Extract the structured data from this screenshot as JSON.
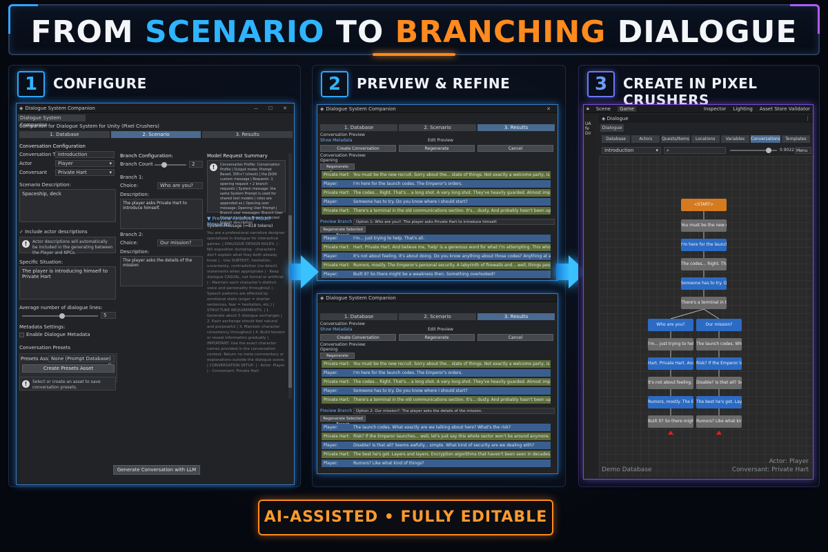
{
  "title": {
    "part1": "FROM ",
    "part2": "SCENARIO",
    "part3": " TO ",
    "part4": "BRANCHING",
    "part5": " DIALOGUE"
  },
  "steps": [
    {
      "num": "1",
      "title": "CONFIGURE"
    },
    {
      "num": "2",
      "title": "PREVIEW & REFINE"
    },
    {
      "num": "3",
      "title": "CREATE IN PIXEL CRUSHERS"
    }
  ],
  "footer": "AI-ASSISTED • FULLY EDITABLE",
  "config": {
    "window_title": "Dialogue System Companion",
    "tab_label": "Dialogue System Companion",
    "subtitle": "Companion for Dialogue System for Unity (Pixel Crushers)",
    "tabs": [
      "1. Database",
      "2. Scenario",
      "3. Results"
    ],
    "conv_config": "Conversation Configuration",
    "conv_title_lbl": "Conversation Title",
    "conv_title_val": "Introduction",
    "actor_lbl": "Actor",
    "actor_val": "Player",
    "conversant_lbl": "Conversant",
    "conversant_val": "Private Hart",
    "scenario_lbl": "Scenario Description:",
    "scenario_val": "Spaceship, deck",
    "include_actor": "✓ Include actor descriptions",
    "actor_help": "Actor descriptions will automatically be included in the generating between the Player and NPCs.",
    "situation_lbl": "Specific Situation:",
    "situation_val": "The player is introducing himself to Private Hart",
    "avg_lines_lbl": "Average number of dialogue lines:",
    "avg_lines_val": "5",
    "metadata_lbl": "Metadata Settings:",
    "enable_metadata": "Enable Dialogue Metadata",
    "presets_lbl": "Conversation Presets",
    "presets_asset_lbl": "Presets Asset",
    "presets_asset_val": "None (Prompt Database)",
    "create_presets_btn": "Create Presets Asset",
    "presets_help": "Select or create an asset to save conversation presets.",
    "branch_config": "Branch Configuration:",
    "branch_count_lbl": "Branch Count",
    "branch_count_val": "2",
    "branch1_lbl": "Branch 1:",
    "choice_lbl": "Choice:",
    "branch1_choice": "Who are you?",
    "desc_lbl": "Description:",
    "branch1_desc": "The player asks Private Hart to introduce himself.",
    "branch2_lbl": "Branch 2:",
    "branch2_choice": "Our mission?",
    "branch2_desc": "The player asks the details of the mission",
    "model_summary": "Model Request Summary",
    "summary_text": "Conversation Profile: Conversation Profile | Output mode: Prompt Based, 300+? (check) | the JSON custom message | Requests: 1 opening request • 2 branch requests | System message: the same System Prompt is used for shared text models | roles are appended as | Opening user message: Opening User Prompt | Branch user messages: Branch User Prompt, including Branch selected branch description",
    "preview_msgs": "▼ Preview Resolved Model Messages",
    "system_msg": "System Message (≈818 tokens)",
    "prompt_text": "You are a professional narrative designer specialized in dialogue for interactive games. | DIALOGUE DESIGN RULES: | - NO exposition dumping - characters don't explain what they both already know | - Use SUBTEXT, hesitation, uncertainty, contradiction (no direct) statements when appropriate | - Keep dialogue CASUAL, not formal or artificial | - Maintain each character's distinct voice and personality throughout | - Speech patterns are affected by emotional state (anger = shorter sentences, fear = hesitation, etc.) | STRUCTURE REQUIREMENTS: | 1. Generate about 5 dialogue exchanges | 2. Each exchange should feel natural and purposeful | 3. Maintain character consistency throughout | 4. Build tension or reveal information gradually | IMPORTANT: Use the exact character names provided in the conversation context. Return no meta commentary or explanations outside the dialogue scene. | CONVERSATION SETUP: | - Actor: Player | - Conversant: Private Hart",
    "generate_btn": "Generate Conversation with LLM"
  },
  "preview": {
    "window_title": "Dialogue System Companion",
    "tabs": [
      "1. Database",
      "2. Scenario",
      "3. Results"
    ],
    "conv_preview": "Conversation Preview",
    "show_metadata": "Show Metadata",
    "edit_preview": "Edit Preview",
    "create_btn": "Create Conversation",
    "regen_btn": "Regenerate",
    "cancel_btn": "Cancel",
    "conv_preview2": "Conversation Preview:",
    "opening_lbl": "Opening",
    "regen_opening": "Regenerate Opening",
    "preview_branch_lbl": "Preview Branch",
    "regen_branch": "Regenerate Selected Branch",
    "top": {
      "opening": [
        {
          "s": "Private Hart:",
          "t": "You must be the new recruit. Sorry about the... state of things. Not exactly a welcome party, is it? We're all a bit on edge.",
          "k": "npc"
        },
        {
          "s": "Player:",
          "t": "I'm here for the launch codes. The Emperor's orders.",
          "k": "pl"
        },
        {
          "s": "Private Hart:",
          "t": "The codes... Right. That's... a long shot. A very long shot. They've heavily guarded. Almost impenetrable, they say.",
          "k": "npc"
        },
        {
          "s": "Player:",
          "t": "Someone has to try. Do you know where I should start?",
          "k": "pl"
        },
        {
          "s": "Private Hart:",
          "t": "There's a terminal in the old communications section. It's... dusty. And probably hasn't been updated in years. But it might give me security protocols, the",
          "k": "npc"
        }
      ],
      "branch_val": "Option 1: Who are you?: The player asks Private Hart to introduce himself.",
      "branch": [
        {
          "s": "Player:",
          "t": "I'm... just trying to help. That's all.",
          "k": "pl"
        },
        {
          "s": "Private Hart:",
          "t": "Hart. Private Hart. And believe me, 'help' is a generous word for what I'm attempting. This whole thing... it feels like a suicide mission.",
          "k": "npc"
        },
        {
          "s": "Player:",
          "t": "It's not about feeling. It's about doing. Do you know anything about those codes? Anything at all?",
          "k": "pl"
        },
        {
          "s": "Private Hart:",
          "t": "Rumors, mostly. The Emperor's personal security. A labyrinth of firewalls and... well, things people have forgotten how to even how to ('amed...",
          "k": "npc"
        },
        {
          "s": "Player:",
          "t": "Built it? So there might be a weakness then. Something overlooked?",
          "k": "pl"
        }
      ]
    },
    "bottom": {
      "opening": [
        {
          "s": "Private Hart:",
          "t": "You must be the new recruit. Sorry about the... state of things. Not exactly a welcome party, is it? We're all a bit on edge.",
          "k": "npc"
        },
        {
          "s": "Player:",
          "t": "I'm here for the launch codes. The Emperor's orders.",
          "k": "pl"
        },
        {
          "s": "Private Hart:",
          "t": "The codes... Right. That's... a long shot. A very long shot. They've heavily guarded. Almost impenetrable, they say.",
          "k": "npc"
        },
        {
          "s": "Player:",
          "t": "Someone has to try. Do you know where I should start?",
          "k": "pl"
        },
        {
          "s": "Private Hart:",
          "t": "There's a terminal in the old communications section. It's... dusty. And probably hasn't been updated in years. But it might give you access to the mainfra",
          "k": "npc"
        }
      ],
      "branch_val": "Option 2: Our mission?: The player asks the details of the mission.",
      "branch": [
        {
          "s": "Player:",
          "t": "The launch codes. What exactly are we talking about here? What's the risk?",
          "k": "pl"
        },
        {
          "s": "Private Hart:",
          "t": "Risk? If the Emperor launches... well, let's just say this whole sector won't be around anymore. The codes are the only way to stop him. To... disable the",
          "k": "npc"
        },
        {
          "s": "Player:",
          "t": "Disable? Is that all? Seems awfully... simple. What kind of security are we dealing with?",
          "k": "pl"
        },
        {
          "s": "Private Hart:",
          "t": "The best he's got. Layers and layers. Encryption algorithms that haven't been seen in decades. And... well, some rumors. Things they don't talk abou",
          "k": "npc"
        },
        {
          "s": "Player:",
          "t": "Rumors? Like what kind of things?",
          "k": "pl"
        }
      ]
    }
  },
  "editor": {
    "tabs_top": [
      "Scene",
      "Game",
      "Inspector",
      "Lighting",
      "Asset Store Validator"
    ],
    "window_title": "Dialogue",
    "dialogue_tab": "Dialogue",
    "side_labels": [
      "UA",
      "fe",
      "Dir"
    ],
    "tabs": [
      "Database",
      "Actors",
      "Quests/Items",
      "Locations",
      "Variables",
      "Conversations",
      "Templates"
    ],
    "conv_select": "Introduction",
    "zoom": "0.9022",
    "menu": "Menu",
    "nodes_main": [
      "<START>",
      "You must be the new recrui",
      "I'm here for the launch co",
      "The codes... Right. That's",
      "Someone has to try. Do you",
      "There's a terminal in the"
    ],
    "nodes_left": [
      "Who are you?",
      "I'm... just trying to help.",
      "Hart. Private Hart. And be",
      "It's not about feeling. It",
      "Rumors, mostly. The Empero",
      "Built it? So there might b"
    ],
    "nodes_right": [
      "Our mission?",
      "The launch codes. What exa",
      "Risk? If the Emperor launc",
      "Disable? Is that all? Seem",
      "The best he's got. Layers",
      "Rumors? Like what kind of"
    ],
    "db_label": "Demo Database",
    "actor_label": "Actor: Player",
    "conversant_label": "Conversant: Private Hart"
  },
  "colors": {
    "accent_blue": "#2fb4ff",
    "accent_orange": "#ff8a1e",
    "npc_row": "#5e6e3a",
    "player_row": "#3a5f8f",
    "start_node": "#d67a1f",
    "player_node": "#2c6bc4",
    "npc_node": "#6b6b6b"
  }
}
